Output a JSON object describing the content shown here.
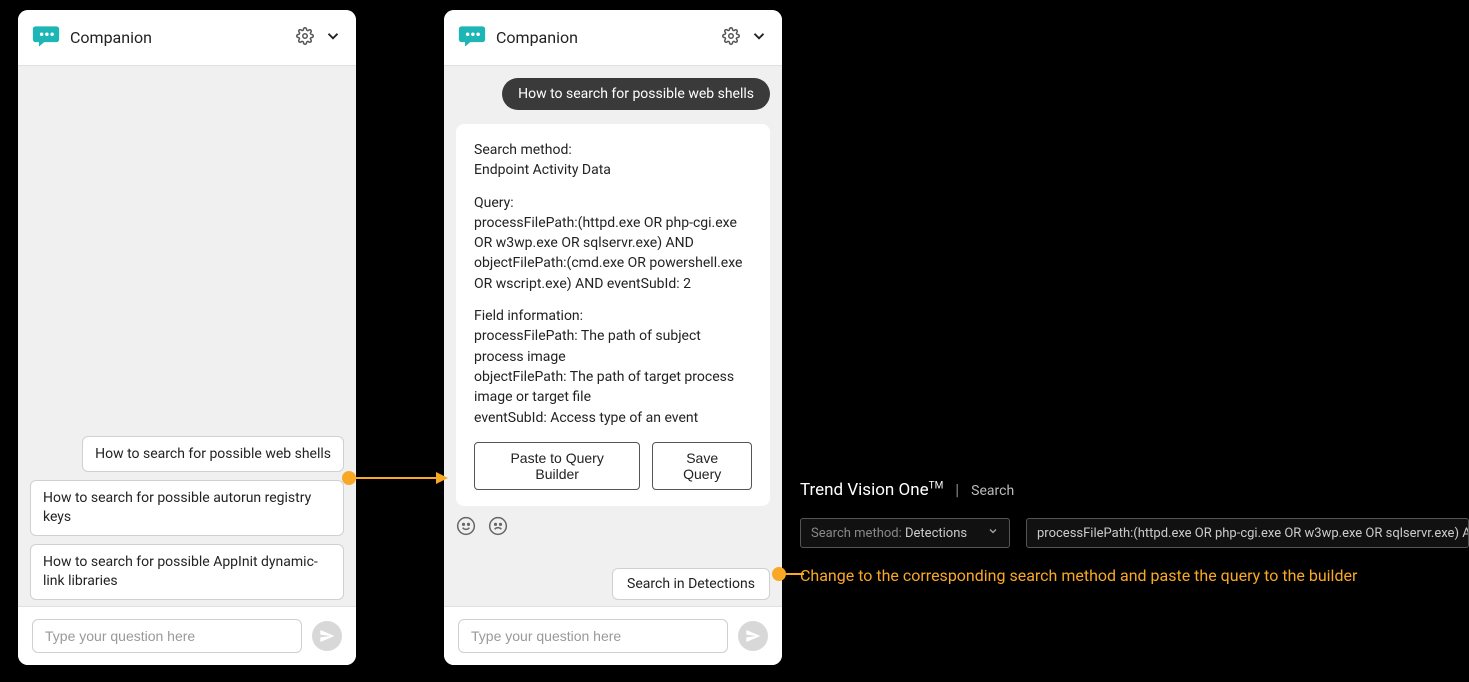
{
  "panel_left": {
    "title": "Companion",
    "suggestions": [
      "How to search for possible web shells",
      "How to search for possible autorun registry keys",
      "How to search for possible AppInit dynamic-link libraries"
    ],
    "input_placeholder": "Type your question here"
  },
  "panel_right": {
    "title": "Companion",
    "user_message": "How to search for possible web shells",
    "answer": {
      "section1_label": "Search method:",
      "section1_value": "Endpoint Activity Data",
      "section2_label": "Query:",
      "section2_value": "processFilePath:(httpd.exe OR php-cgi.exe OR w3wp.exe OR sqlservr.exe) AND objectFilePath:(cmd.exe OR powershell.exe OR wscript.exe) AND eventSubId: 2",
      "section3_label": "Field information:",
      "section3_l1": "processFilePath: The path of subject process image",
      "section3_l2": "objectFilePath: The path of target process image or target file",
      "section3_l3": "eventSubId: Access type of an event",
      "btn_paste": "Paste to Query Builder",
      "btn_save": "Save Query"
    },
    "search_link": "Search in Detections",
    "input_placeholder": "Type your question here"
  },
  "vision": {
    "product": "Trend Vision One",
    "tm": "TM",
    "page": "Search",
    "method_label": "Search method:",
    "method_value": "Detections",
    "query_text": "processFilePath:(httpd.exe OR php-cgi.exe OR w3wp.exe OR sqlservr.exe) AND objectFileP",
    "annotation": "Change to the corresponding search method and paste the query to the builder"
  }
}
